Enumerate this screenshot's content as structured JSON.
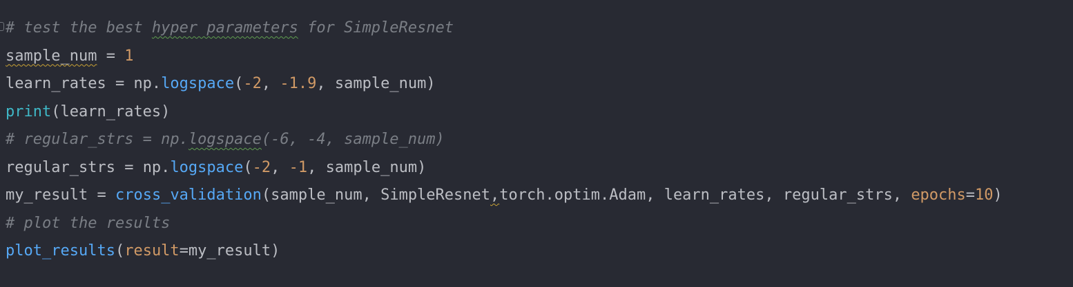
{
  "code": {
    "line1": {
      "prefix": "# test the best ",
      "hyper_parameters": "hyper parameters",
      "suffix": " for SimpleResnet"
    },
    "line2": {
      "var": "sample_num",
      "eq": " = ",
      "val": "1"
    },
    "line3": {
      "var": "learn_rates",
      "eq": " = np.",
      "fn": "logspace",
      "open": "(",
      "a": "-2",
      "sep1": ", ",
      "b": "-1.9",
      "rest": ", sample_num)"
    },
    "line4": {
      "fn": "print",
      "rest": "(learn_rates)"
    },
    "line5": {
      "prefix": "# regular_strs = np.",
      "logspace": "logspace",
      "suffix": "(-6, -4, sample_num)"
    },
    "line6": {
      "var": "regular_strs",
      "eq": " = np.",
      "fn": "logspace",
      "open": "(",
      "a": "-2",
      "sep1": ", ",
      "b": "-1",
      "rest": ", sample_num)"
    },
    "line7": {
      "var": "my_result",
      "eq": " = ",
      "fn": "cross_validation",
      "args1": "(sample_num, SimpleResnet",
      "comma": ",",
      "args2": "torch.optim.Adam, learn_rates, regular_strs, ",
      "kw": "epochs",
      "eqkw": "=",
      "val": "10",
      "close": ")"
    },
    "line8": {
      "text": "# plot the results"
    },
    "line9": {
      "fn": "plot_results",
      "open": "(",
      "kw": "result",
      "rest": "=my_result)"
    }
  }
}
